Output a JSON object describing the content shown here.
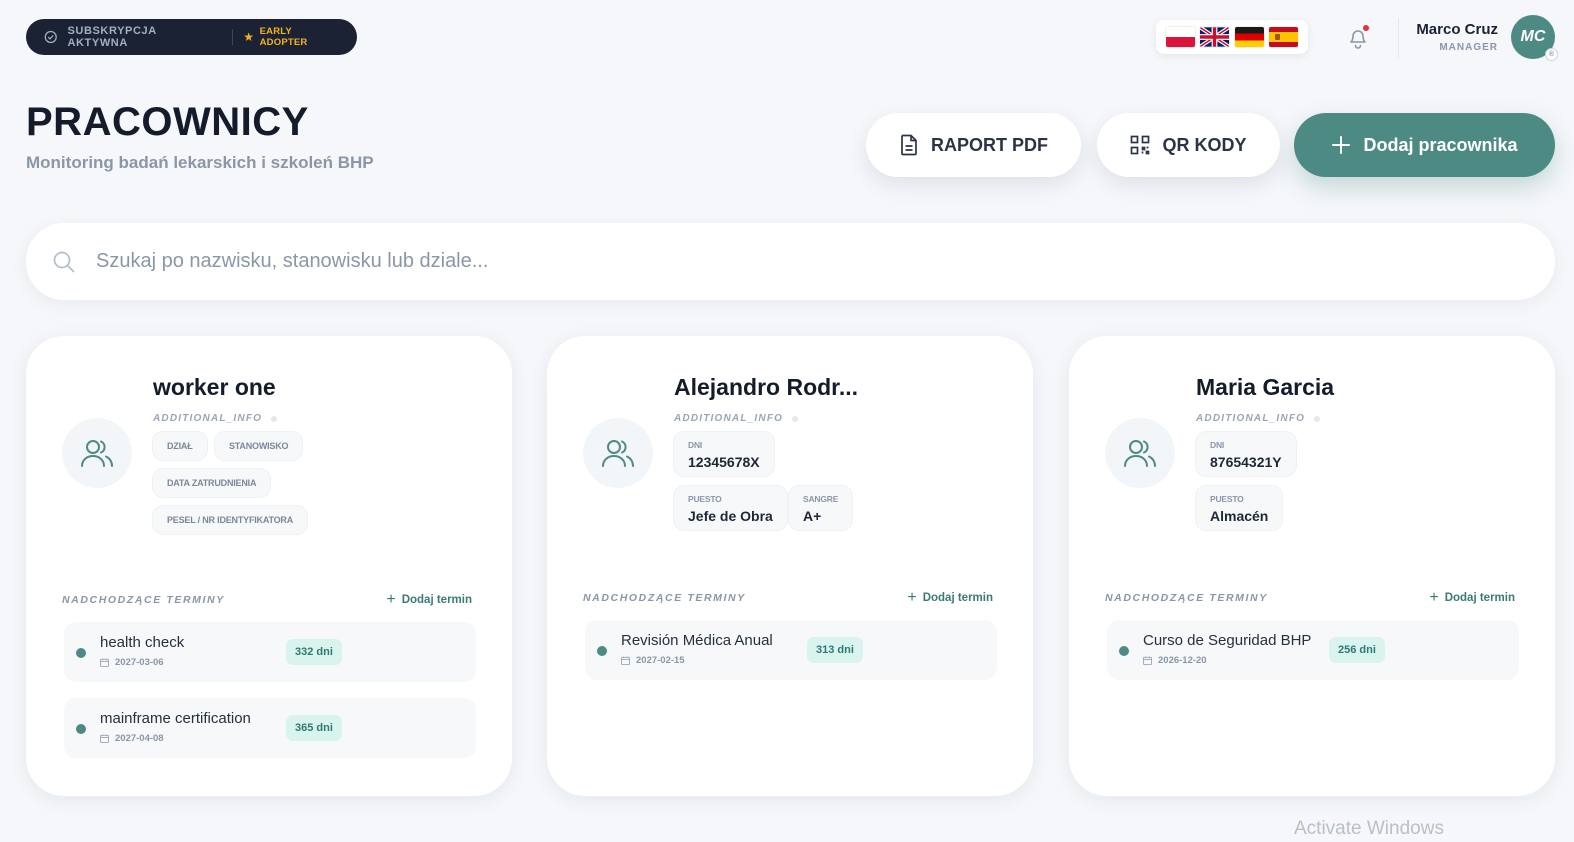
{
  "topbar": {
    "subscription_label": "SUBSKRYPCJA AKTYWNA",
    "early_adopter_label": "EARLY ADOPTER",
    "languages": [
      "pl",
      "en",
      "de",
      "es"
    ],
    "user": {
      "name": "Marco Cruz",
      "role": "MANAGER",
      "initials": "MC"
    }
  },
  "header": {
    "title": "PRACOWNICY",
    "subtitle": "Monitoring badań lekarskich i szkoleń BHP",
    "buttons": {
      "pdf": "RAPORT PDF",
      "qr": "QR KODY",
      "add": "Dodaj pracownika"
    }
  },
  "search": {
    "placeholder": "Szukaj po nazwisku, stanowisku lub dziale..."
  },
  "section_labels": {
    "upcoming": "NADCHODZĄCE TERMINY",
    "add_term": "Dodaj termin"
  },
  "workers": [
    {
      "name": "worker one",
      "info_label": "ADDITIONAL_INFO",
      "tags": [
        "DZIAŁ",
        "STANOWISKO",
        "DATA ZATRUDNIENIA",
        "PESEL / NR IDENTYFIKATORA"
      ],
      "fields": [],
      "terms": [
        {
          "name": "health check",
          "date": "2027-03-06",
          "days": "332 dni"
        },
        {
          "name": "mainframe certification",
          "date": "2027-04-08",
          "days": "365 dni"
        }
      ]
    },
    {
      "name": "Alejandro Rodr...",
      "info_label": "ADDITIONAL_INFO",
      "tags": [],
      "fields": [
        {
          "key": "DNI",
          "value": "12345678X"
        },
        {
          "key": "PUESTO",
          "value": "Jefe de Obra"
        },
        {
          "key": "SANGRE",
          "value": "A+"
        }
      ],
      "terms": [
        {
          "name": "Revisión Médica Anual",
          "date": "2027-02-15",
          "days": "313 dni"
        }
      ]
    },
    {
      "name": "Maria Garcia",
      "info_label": "ADDITIONAL_INFO",
      "tags": [],
      "fields": [
        {
          "key": "DNI",
          "value": "87654321Y"
        },
        {
          "key": "PUESTO",
          "value": "Almacén"
        }
      ],
      "terms": [
        {
          "name": "Curso de Seguridad BHP",
          "date": "2026-12-20",
          "days": "256 dni"
        }
      ]
    }
  ],
  "watermark": "Activate Windows",
  "colors": {
    "accent": "#4e8a84",
    "dark": "#1a2233",
    "badge_bg": "#d9f3ef",
    "early_adopter": "#f5b31b"
  }
}
